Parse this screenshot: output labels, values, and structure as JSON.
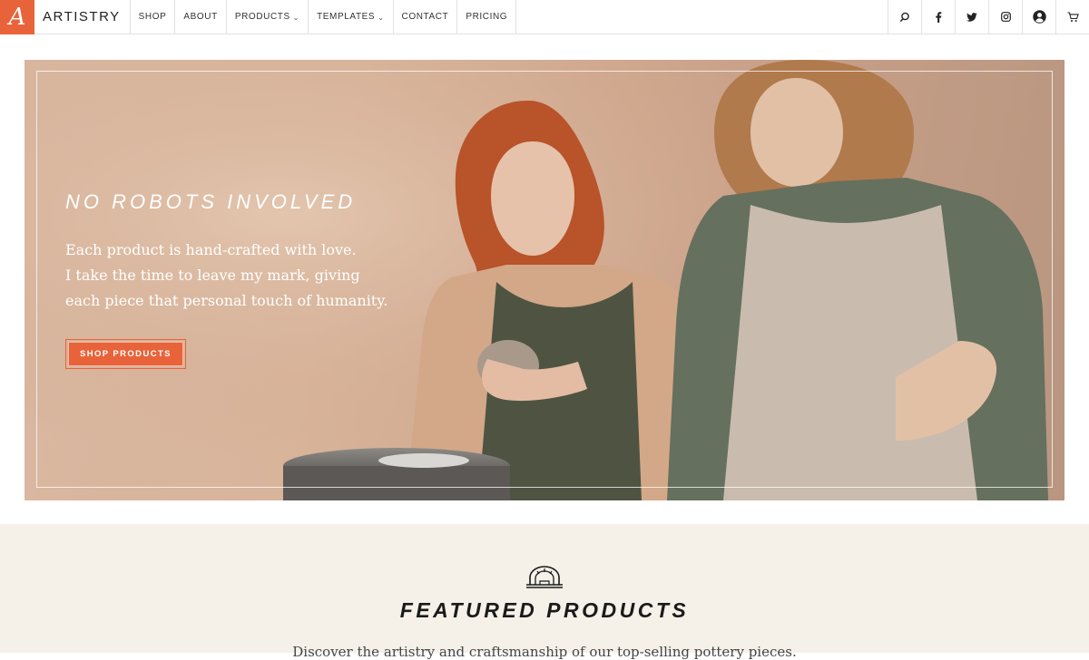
{
  "brand": {
    "logo_letter": "A",
    "name": "ARTISTRY",
    "accent_color": "#e8633a"
  },
  "nav": {
    "items": [
      {
        "label": "SHOP",
        "has_dropdown": false
      },
      {
        "label": "ABOUT",
        "has_dropdown": false
      },
      {
        "label": "PRODUCTS",
        "has_dropdown": true
      },
      {
        "label": "TEMPLATES",
        "has_dropdown": true
      },
      {
        "label": "CONTACT",
        "has_dropdown": false
      },
      {
        "label": "PRICING",
        "has_dropdown": false
      }
    ],
    "caret_glyph": "⌄"
  },
  "header_icons": [
    "search-icon",
    "facebook-icon",
    "twitter-icon",
    "instagram-icon",
    "account-icon",
    "cart-icon"
  ],
  "hero": {
    "title": "NO ROBOTS INVOLVED",
    "lines": [
      "Each product is hand-crafted with love.",
      "I take the time to leave my mark, giving",
      "each piece that personal touch of humanity."
    ],
    "button_label": "SHOP PRODUCTS"
  },
  "featured": {
    "title": "FEATURED PRODUCTS",
    "subtitle": "Discover the artistry and craftsmanship of our top-selling pottery pieces."
  }
}
